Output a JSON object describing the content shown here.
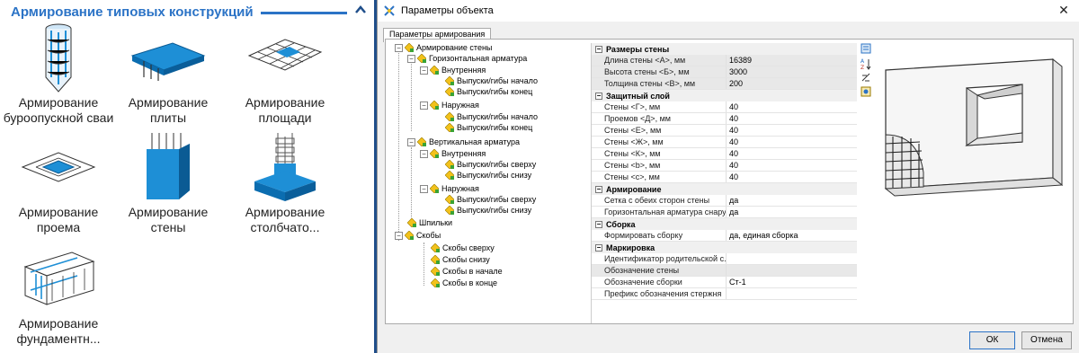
{
  "left_panel": {
    "title": "Армирование типовых конструкций",
    "tiles": [
      {
        "label": "Армирование буроопускной сваи",
        "icon": "pile-reinforcement-icon"
      },
      {
        "label": "Армирование плиты",
        "icon": "slab-reinforcement-icon"
      },
      {
        "label": "Армирование площади",
        "icon": "area-reinforcement-icon"
      },
      {
        "label": "Армирование проема",
        "icon": "opening-reinforcement-icon"
      },
      {
        "label": "Армирование стены",
        "icon": "wall-reinforcement-icon"
      },
      {
        "label": "Армирование столбчато...",
        "icon": "column-footing-reinforcement-icon"
      },
      {
        "label": "Армирование фундаментн...",
        "icon": "foundation-reinforcement-icon"
      }
    ]
  },
  "dialog": {
    "title": "Параметры объекта",
    "close": "✕",
    "tab": "Параметры армирования",
    "tree": {
      "root": "Армирование стены",
      "horizontal": "Горизонтальная арматура",
      "inner": "Внутренняя",
      "start": "Выпуски/гибы начало",
      "end": "Выпуски/гибы конец",
      "outer": "Наружная",
      "vertical": "Вертикальная арматура",
      "top": "Выпуски/гибы сверху",
      "bottom": "Выпуски/гибы снизу",
      "pins": "Шпильки",
      "brackets": "Скобы",
      "br_top": "Скобы сверху",
      "br_bottom": "Скобы снизу",
      "br_start": "Скобы в начале",
      "br_end": "Скобы в конце"
    },
    "grid": {
      "cat1": "Размеры стены",
      "r_len_name": "Длина стены <А>, мм",
      "r_len_val": "16389",
      "r_h_name": "Высота стены <Б>, мм",
      "r_h_val": "3000",
      "r_t_name": "Толщина стены <В>, мм",
      "r_t_val": "200",
      "cat2": "Защитный слой",
      "r_g_name": "Стены <Г>, мм",
      "r_g_val": "40",
      "r_d_name": "Проемов <Д>, мм",
      "r_d_val": "40",
      "r_e_name": "Стены <Е>, мм",
      "r_e_val": "40",
      "r_zh_name": "Стены <Ж>, мм",
      "r_zh_val": "40",
      "r_k_name": "Стены <К>, мм",
      "r_k_val": "40",
      "r_b_name": "Стены <b>, мм",
      "r_b_val": "40",
      "r_c_name": "Стены <с>, мм",
      "r_c_val": "40",
      "cat3": "Армирование",
      "r_mesh_name": "Сетка с обеих сторон стены",
      "r_mesh_val": "да",
      "r_hor_name": "Горизонтальная арматура снару...",
      "r_hor_val": "да",
      "cat4": "Сборка",
      "r_asm_name": "Формировать сборку",
      "r_asm_val": "да, единая сборка",
      "cat5": "Маркировка",
      "r_pid_name": "Идентификатор родительской с...",
      "r_pid_val": "",
      "r_wall_name": "Обозначение стены",
      "r_wall_val": "",
      "r_asmname_name": "Обозначение сборки",
      "r_asmname_val": "Ст-1",
      "r_pref_name": "Префикс обозначения стержня",
      "r_pref_val": ""
    },
    "ok": "ОК",
    "cancel": "Отмена"
  },
  "colors": {
    "accent": "#2b73c6",
    "icon_blue": "#1e8fd6",
    "gem_yellow": "#f2c21b",
    "gem_green": "#3aa335"
  }
}
